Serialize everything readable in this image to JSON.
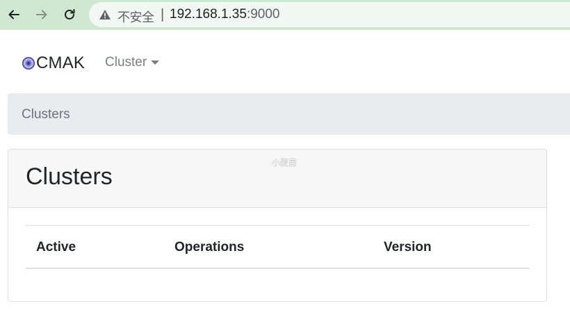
{
  "browser": {
    "security_label": "不安全",
    "separator": "|",
    "url_host": "192.168.1.35",
    "url_port": ":9000"
  },
  "navbar": {
    "brand": "CMAK",
    "cluster_menu": "Cluster"
  },
  "breadcrumb": {
    "current": "Clusters"
  },
  "card": {
    "title": "Clusters",
    "watermark": "小麦苗",
    "table": {
      "headers": [
        "Active",
        "Operations",
        "Version"
      ],
      "rows": []
    }
  },
  "colors": {
    "chrome_bg": "#cfe8d2",
    "breadcrumb_bg": "#e9ecef",
    "card_header_bg": "#f7f7f7"
  }
}
